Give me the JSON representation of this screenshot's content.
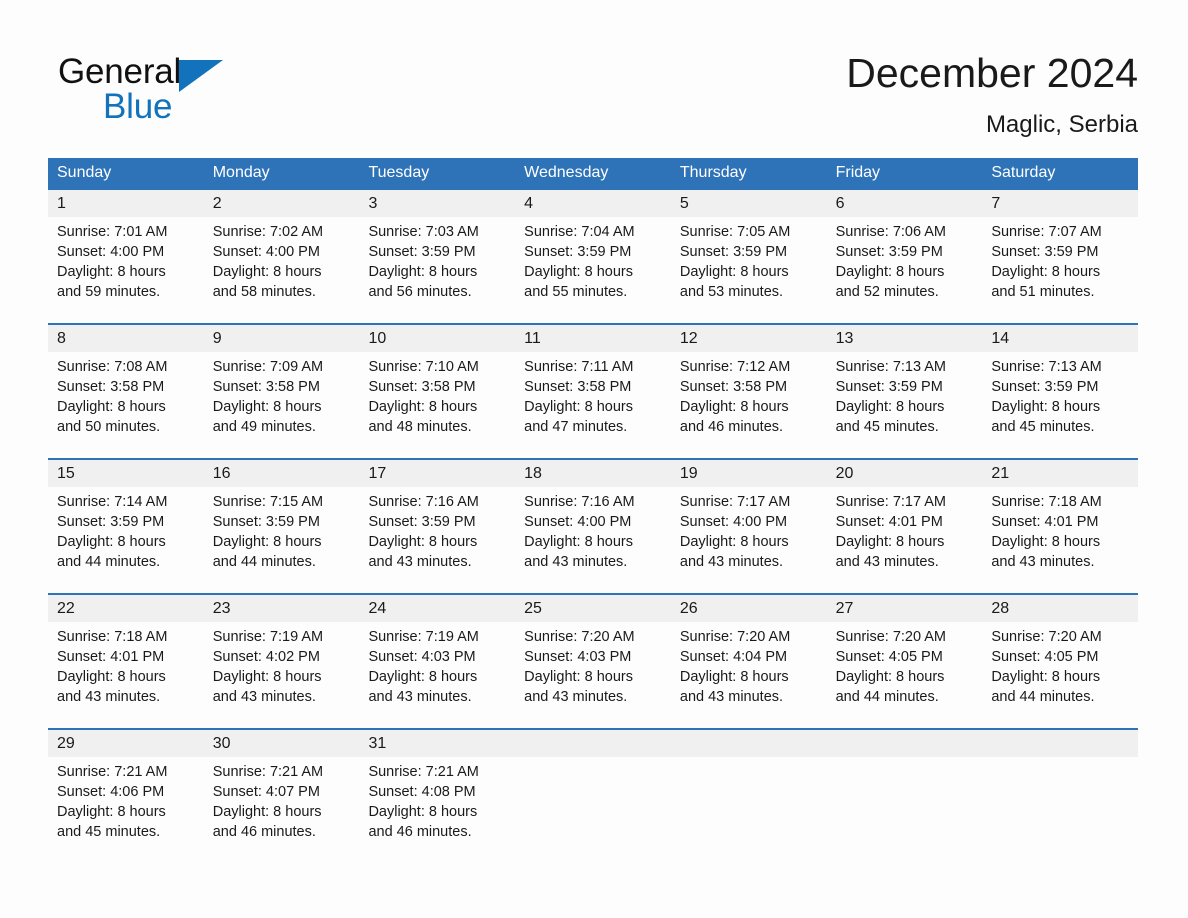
{
  "brand": {
    "name_part1": "General",
    "name_part2": "Blue",
    "triangle_icon": "triangle-right-icon",
    "accent_color": "#1272bc"
  },
  "header": {
    "title": "December 2024",
    "location": "Maglic, Serbia"
  },
  "theme": {
    "header_blue": "#2e73b8",
    "daynum_band": "#f0f0f0",
    "page_background": "#fdfdfd",
    "text_color": "#1a1a1a"
  },
  "calendar": {
    "weekdays": [
      "Sunday",
      "Monday",
      "Tuesday",
      "Wednesday",
      "Thursday",
      "Friday",
      "Saturday"
    ],
    "weeks": [
      {
        "days": [
          {
            "num": "1",
            "sunrise": "Sunrise: 7:01 AM",
            "sunset": "Sunset: 4:00 PM",
            "daylight1": "Daylight: 8 hours",
            "daylight2": "and 59 minutes."
          },
          {
            "num": "2",
            "sunrise": "Sunrise: 7:02 AM",
            "sunset": "Sunset: 4:00 PM",
            "daylight1": "Daylight: 8 hours",
            "daylight2": "and 58 minutes."
          },
          {
            "num": "3",
            "sunrise": "Sunrise: 7:03 AM",
            "sunset": "Sunset: 3:59 PM",
            "daylight1": "Daylight: 8 hours",
            "daylight2": "and 56 minutes."
          },
          {
            "num": "4",
            "sunrise": "Sunrise: 7:04 AM",
            "sunset": "Sunset: 3:59 PM",
            "daylight1": "Daylight: 8 hours",
            "daylight2": "and 55 minutes."
          },
          {
            "num": "5",
            "sunrise": "Sunrise: 7:05 AM",
            "sunset": "Sunset: 3:59 PM",
            "daylight1": "Daylight: 8 hours",
            "daylight2": "and 53 minutes."
          },
          {
            "num": "6",
            "sunrise": "Sunrise: 7:06 AM",
            "sunset": "Sunset: 3:59 PM",
            "daylight1": "Daylight: 8 hours",
            "daylight2": "and 52 minutes."
          },
          {
            "num": "7",
            "sunrise": "Sunrise: 7:07 AM",
            "sunset": "Sunset: 3:59 PM",
            "daylight1": "Daylight: 8 hours",
            "daylight2": "and 51 minutes."
          }
        ]
      },
      {
        "days": [
          {
            "num": "8",
            "sunrise": "Sunrise: 7:08 AM",
            "sunset": "Sunset: 3:58 PM",
            "daylight1": "Daylight: 8 hours",
            "daylight2": "and 50 minutes."
          },
          {
            "num": "9",
            "sunrise": "Sunrise: 7:09 AM",
            "sunset": "Sunset: 3:58 PM",
            "daylight1": "Daylight: 8 hours",
            "daylight2": "and 49 minutes."
          },
          {
            "num": "10",
            "sunrise": "Sunrise: 7:10 AM",
            "sunset": "Sunset: 3:58 PM",
            "daylight1": "Daylight: 8 hours",
            "daylight2": "and 48 minutes."
          },
          {
            "num": "11",
            "sunrise": "Sunrise: 7:11 AM",
            "sunset": "Sunset: 3:58 PM",
            "daylight1": "Daylight: 8 hours",
            "daylight2": "and 47 minutes."
          },
          {
            "num": "12",
            "sunrise": "Sunrise: 7:12 AM",
            "sunset": "Sunset: 3:58 PM",
            "daylight1": "Daylight: 8 hours",
            "daylight2": "and 46 minutes."
          },
          {
            "num": "13",
            "sunrise": "Sunrise: 7:13 AM",
            "sunset": "Sunset: 3:59 PM",
            "daylight1": "Daylight: 8 hours",
            "daylight2": "and 45 minutes."
          },
          {
            "num": "14",
            "sunrise": "Sunrise: 7:13 AM",
            "sunset": "Sunset: 3:59 PM",
            "daylight1": "Daylight: 8 hours",
            "daylight2": "and 45 minutes."
          }
        ]
      },
      {
        "days": [
          {
            "num": "15",
            "sunrise": "Sunrise: 7:14 AM",
            "sunset": "Sunset: 3:59 PM",
            "daylight1": "Daylight: 8 hours",
            "daylight2": "and 44 minutes."
          },
          {
            "num": "16",
            "sunrise": "Sunrise: 7:15 AM",
            "sunset": "Sunset: 3:59 PM",
            "daylight1": "Daylight: 8 hours",
            "daylight2": "and 44 minutes."
          },
          {
            "num": "17",
            "sunrise": "Sunrise: 7:16 AM",
            "sunset": "Sunset: 3:59 PM",
            "daylight1": "Daylight: 8 hours",
            "daylight2": "and 43 minutes."
          },
          {
            "num": "18",
            "sunrise": "Sunrise: 7:16 AM",
            "sunset": "Sunset: 4:00 PM",
            "daylight1": "Daylight: 8 hours",
            "daylight2": "and 43 minutes."
          },
          {
            "num": "19",
            "sunrise": "Sunrise: 7:17 AM",
            "sunset": "Sunset: 4:00 PM",
            "daylight1": "Daylight: 8 hours",
            "daylight2": "and 43 minutes."
          },
          {
            "num": "20",
            "sunrise": "Sunrise: 7:17 AM",
            "sunset": "Sunset: 4:01 PM",
            "daylight1": "Daylight: 8 hours",
            "daylight2": "and 43 minutes."
          },
          {
            "num": "21",
            "sunrise": "Sunrise: 7:18 AM",
            "sunset": "Sunset: 4:01 PM",
            "daylight1": "Daylight: 8 hours",
            "daylight2": "and 43 minutes."
          }
        ]
      },
      {
        "days": [
          {
            "num": "22",
            "sunrise": "Sunrise: 7:18 AM",
            "sunset": "Sunset: 4:01 PM",
            "daylight1": "Daylight: 8 hours",
            "daylight2": "and 43 minutes."
          },
          {
            "num": "23",
            "sunrise": "Sunrise: 7:19 AM",
            "sunset": "Sunset: 4:02 PM",
            "daylight1": "Daylight: 8 hours",
            "daylight2": "and 43 minutes."
          },
          {
            "num": "24",
            "sunrise": "Sunrise: 7:19 AM",
            "sunset": "Sunset: 4:03 PM",
            "daylight1": "Daylight: 8 hours",
            "daylight2": "and 43 minutes."
          },
          {
            "num": "25",
            "sunrise": "Sunrise: 7:20 AM",
            "sunset": "Sunset: 4:03 PM",
            "daylight1": "Daylight: 8 hours",
            "daylight2": "and 43 minutes."
          },
          {
            "num": "26",
            "sunrise": "Sunrise: 7:20 AM",
            "sunset": "Sunset: 4:04 PM",
            "daylight1": "Daylight: 8 hours",
            "daylight2": "and 43 minutes."
          },
          {
            "num": "27",
            "sunrise": "Sunrise: 7:20 AM",
            "sunset": "Sunset: 4:05 PM",
            "daylight1": "Daylight: 8 hours",
            "daylight2": "and 44 minutes."
          },
          {
            "num": "28",
            "sunrise": "Sunrise: 7:20 AM",
            "sunset": "Sunset: 4:05 PM",
            "daylight1": "Daylight: 8 hours",
            "daylight2": "and 44 minutes."
          }
        ]
      },
      {
        "days": [
          {
            "num": "29",
            "sunrise": "Sunrise: 7:21 AM",
            "sunset": "Sunset: 4:06 PM",
            "daylight1": "Daylight: 8 hours",
            "daylight2": "and 45 minutes."
          },
          {
            "num": "30",
            "sunrise": "Sunrise: 7:21 AM",
            "sunset": "Sunset: 4:07 PM",
            "daylight1": "Daylight: 8 hours",
            "daylight2": "and 46 minutes."
          },
          {
            "num": "31",
            "sunrise": "Sunrise: 7:21 AM",
            "sunset": "Sunset: 4:08 PM",
            "daylight1": "Daylight: 8 hours",
            "daylight2": "and 46 minutes."
          },
          {
            "num": "",
            "sunrise": "",
            "sunset": "",
            "daylight1": "",
            "daylight2": ""
          },
          {
            "num": "",
            "sunrise": "",
            "sunset": "",
            "daylight1": "",
            "daylight2": ""
          },
          {
            "num": "",
            "sunrise": "",
            "sunset": "",
            "daylight1": "",
            "daylight2": ""
          },
          {
            "num": "",
            "sunrise": "",
            "sunset": "",
            "daylight1": "",
            "daylight2": ""
          }
        ]
      }
    ]
  }
}
